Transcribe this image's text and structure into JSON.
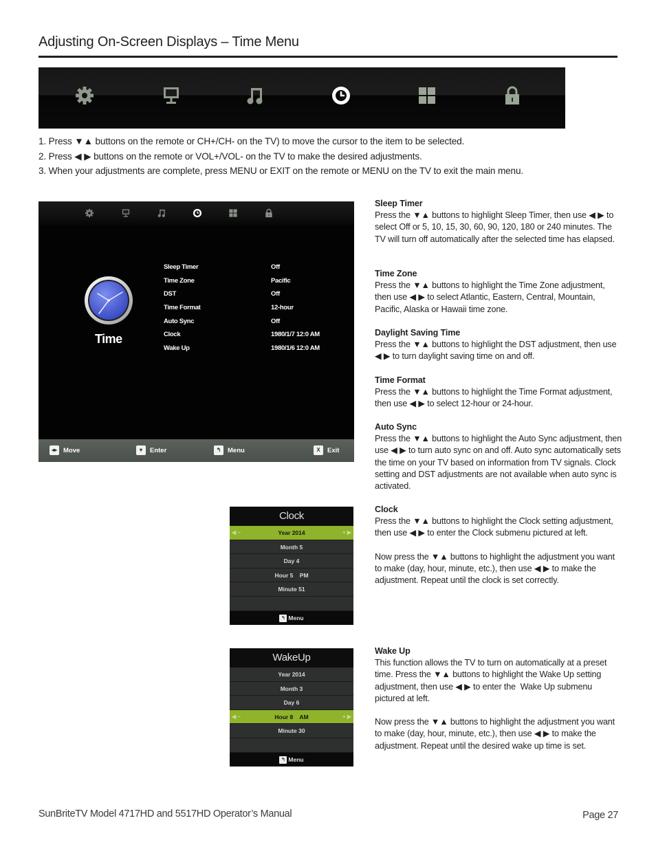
{
  "header": {
    "title": "Adjusting On-Screen Displays – Time Menu"
  },
  "icon_bar": {
    "icons": [
      "gear-icon",
      "monitor-icon",
      "music-note-icon",
      "clock-icon",
      "grid-icon",
      "lock-icon"
    ],
    "selected": "clock-icon"
  },
  "steps": [
    "1. Press ▼▲ buttons on the remote or CH+/CH- on the TV) to move the cursor to the item to be selected.",
    "2. Press ◀ ▶ buttons on the remote or VOL+/VOL- on the TV to make the desired adjustments.",
    "3. When your adjustments are complete, press MENU or EXIT on the remote or MENU on the TV to exit the main menu."
  ],
  "time_menu": {
    "section_label": "Time",
    "rows": [
      {
        "label": "Sleep Timer",
        "value": "Off"
      },
      {
        "label": "Time Zone",
        "value": "Pacific"
      },
      {
        "label": "DST",
        "value": "Off"
      },
      {
        "label": "Time Format",
        "value": "12-hour"
      },
      {
        "label": "Auto Sync",
        "value": "Off"
      },
      {
        "label": "Clock",
        "value": "1980/1/7 12:0 AM"
      },
      {
        "label": "Wake Up",
        "value": "1980/1/6 12:0 AM"
      }
    ],
    "footer": [
      {
        "icon": "move-icon",
        "glyph": "◂▸",
        "label": "Move"
      },
      {
        "icon": "enter-icon",
        "glyph": "▾",
        "label": "Enter"
      },
      {
        "icon": "menu-return-icon",
        "glyph": "↰",
        "label": "Menu"
      },
      {
        "icon": "exit-icon",
        "glyph": "X",
        "label": "Exit"
      }
    ]
  },
  "clock_submenu": {
    "title": "Clock",
    "rows": [
      {
        "label": "Year 2014",
        "selected": true
      },
      {
        "label": "Month 5",
        "selected": false
      },
      {
        "label": "Day 4",
        "selected": false
      },
      {
        "label": "Hour 5    PM",
        "selected": false
      },
      {
        "label": "Minute 51",
        "selected": false
      },
      {
        "label": "",
        "selected": false
      }
    ],
    "left_arrows": "◀ −",
    "right_arrows": "+ ▶",
    "footer_glyph": "↰",
    "footer_label": "Menu"
  },
  "wakeup_submenu": {
    "title": "WakeUp",
    "rows": [
      {
        "label": "Year 2014",
        "selected": false
      },
      {
        "label": "Month 3",
        "selected": false
      },
      {
        "label": "Day 6",
        "selected": false
      },
      {
        "label": "Hour 8    AM",
        "selected": true
      },
      {
        "label": "Minute 30",
        "selected": false
      },
      {
        "label": "",
        "selected": false
      }
    ],
    "left_arrows": "◀ −",
    "right_arrows": "+ ▶",
    "footer_glyph": "↰",
    "footer_label": "Menu"
  },
  "descriptions": {
    "sleep_timer": {
      "heading": "Sleep Timer",
      "paragraphs": [
        "Press the ▼▲ buttons to highlight Sleep Timer, then use ◀ ▶ to select Off or 5, 10, 15, 30, 60, 90, 120, 180 or 240 minutes. The TV will turn off automatically after the selected time has elapsed."
      ]
    },
    "time_zone": {
      "heading": "Time Zone",
      "paragraphs": [
        "Press the ▼▲ buttons to highlight the Time Zone adjustment, then use ◀ ▶ to select Atlantic, Eastern, Central, Mountain, Pacific, Alaska or Hawaii time zone."
      ]
    },
    "dst": {
      "heading": "Daylight Saving Time",
      "paragraphs": [
        "Press the ▼▲ buttons to highlight the DST adjustment, then use ◀ ▶ to turn daylight saving time on and off."
      ]
    },
    "time_format": {
      "heading": "Time Format",
      "paragraphs": [
        "Press the ▼▲ buttons to highlight the Time Format adjustment, then use ◀ ▶ to select 12-hour or 24-hour."
      ]
    },
    "auto_sync": {
      "heading": "Auto Sync",
      "paragraphs": [
        "Press the ▼▲ buttons to highlight the Auto Sync adjustment, then use ◀ ▶ to turn auto sync on and off. Auto sync automatically sets the time on your TV based on information from TV signals. Clock setting and DST adjustments are not available when auto sync is activated."
      ]
    },
    "clock": {
      "heading": "Clock",
      "paragraphs": [
        "Press the ▼▲ buttons to highlight the Clock setting adjustment, then use ◀ ▶ to enter the Clock submenu pictured at left.",
        "Now press the ▼▲ buttons to highlight the adjustment you want to make (day, hour, minute, etc.), then use ◀ ▶ to make the adjustment. Repeat until the clock is set correctly."
      ]
    },
    "wake_up": {
      "heading": "Wake Up",
      "paragraphs": [
        "This function allows the TV to turn on automatically at a preset time. Press the ▼▲ buttons to highlight the Wake Up setting adjustment, then use ◀ ▶ to enter the  Wake Up submenu pictured at left.",
        "Now press the ▼▲ buttons to highlight the adjustment you want to make (day, hour, minute, etc.), then use ◀ ▶ to make the adjustment. Repeat until the desired wake up time is set."
      ]
    }
  },
  "footer": {
    "manual_title": "SunBriteTV Model 4717HD and 5517HD Operator’s Manual",
    "page": "Page 27"
  },
  "colors": {
    "highlight_green": "#8fb32a",
    "icon_inactive": "#9aa596",
    "icon_active": "#ffffff",
    "clock_face_blue": "#4a63d8"
  }
}
